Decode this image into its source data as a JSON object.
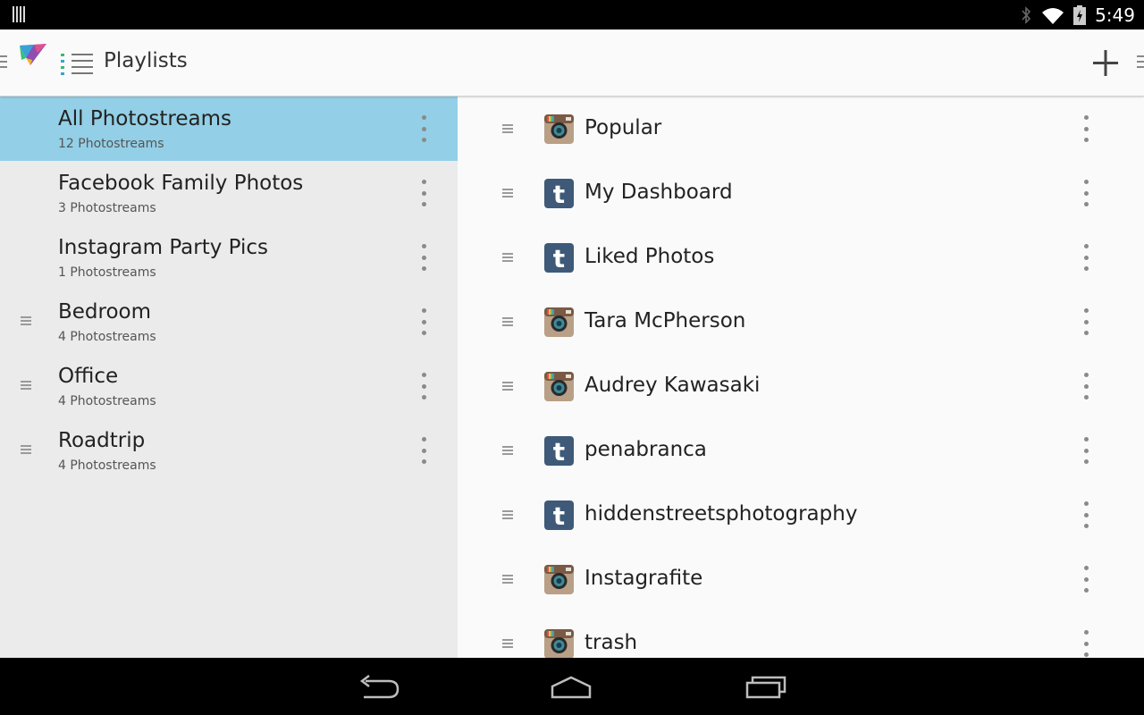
{
  "status_bar": {
    "time": "5:49",
    "icons": [
      "notification-icon",
      "bluetooth-icon",
      "wifi-icon",
      "battery-icon"
    ]
  },
  "action_bar": {
    "title": "Playlists",
    "logo_icon": "app-logo-icon",
    "list_icon": "playlist-icon",
    "add_icon": "plus-icon"
  },
  "playlists": [
    {
      "name": "All Photostreams",
      "count": "12 Photostreams",
      "selected": true,
      "draggable": false
    },
    {
      "name": "Facebook Family Photos",
      "count": "3 Photostreams",
      "selected": false,
      "draggable": false
    },
    {
      "name": "Instagram Party Pics",
      "count": "1 Photostreams",
      "selected": false,
      "draggable": false
    },
    {
      "name": "Bedroom",
      "count": "4 Photostreams",
      "selected": false,
      "draggable": true
    },
    {
      "name": "Office",
      "count": "4 Photostreams",
      "selected": false,
      "draggable": true
    },
    {
      "name": "Roadtrip",
      "count": "4 Photostreams",
      "selected": false,
      "draggable": true
    }
  ],
  "photostreams": [
    {
      "name": "Popular",
      "service": "instagram"
    },
    {
      "name": "My Dashboard",
      "service": "tumblr"
    },
    {
      "name": "Liked Photos",
      "service": "tumblr"
    },
    {
      "name": "Tara McPherson",
      "service": "instagram"
    },
    {
      "name": "Audrey Kawasaki",
      "service": "instagram"
    },
    {
      "name": "penabranca",
      "service": "tumblr"
    },
    {
      "name": "hiddenstreetsphotography",
      "service": "tumblr"
    },
    {
      "name": "Instagrafite",
      "service": "instagram"
    },
    {
      "name": "trash",
      "service": "instagram"
    }
  ],
  "nav_bar": {
    "buttons": [
      "back-icon",
      "home-icon",
      "recents-icon"
    ]
  },
  "colors": {
    "selected_bg": "#93cfe6",
    "left_bg": "#ebebeb",
    "right_bg": "#fafafa",
    "tumblr": "#3e5a78",
    "instagram_body": "#b89f86"
  }
}
